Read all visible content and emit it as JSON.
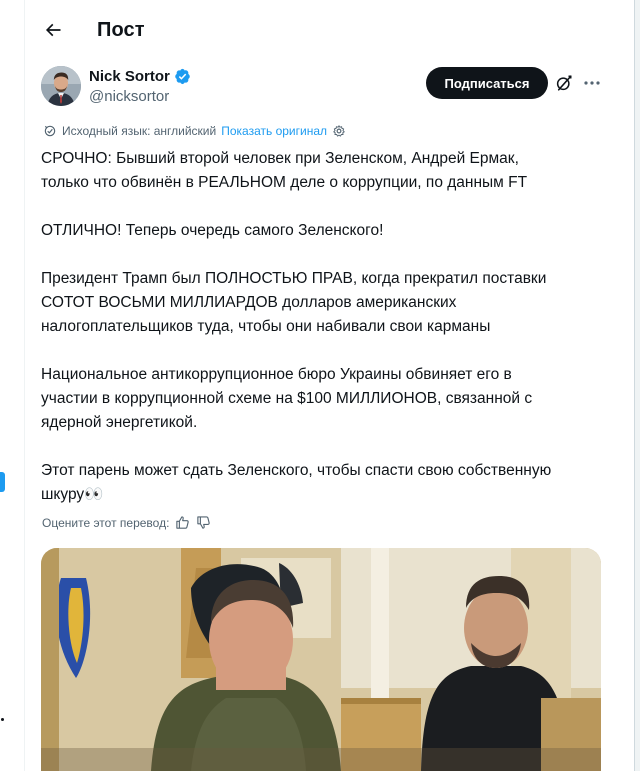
{
  "header": {
    "title": "Пост"
  },
  "author": {
    "name": "Nick Sortor",
    "handle": "@nicksortor",
    "follow_label": "Подписаться"
  },
  "translation": {
    "source_label": "Исходный язык: английский",
    "show_original": "Показать оригинал"
  },
  "tweet": {
    "paragraphs": [
      [
        "СРОЧНО: Бывший второй человек при Зеленском, Андрей Ермак,",
        "только что обвинён в РЕАЛЬНОМ деле о коррупции, по данным FT"
      ],
      [
        "ОТЛИЧНО! Теперь очередь самого Зеленского!"
      ],
      [
        "Президент Трамп был ПОЛНОСТЬЮ ПРАВ, когда прекратил поставки",
        "СОТОТ ВОСЬМИ МИЛЛИАРДОВ долларов американских",
        "налогоплательщиков туда, чтобы они набивали свои карманы"
      ],
      [
        "Национальное антикоррупционное бюро Украины обвиняет его в",
        "участии в коррупционной схеме на $100 МИЛЛИОНОВ, связанной с",
        "ядерной энергетикой."
      ],
      [
        "Этот парень может сдать Зеленского, чтобы спасти свою собственную",
        "шкуру👀"
      ]
    ]
  },
  "rating": {
    "label": "Оцените этот перевод:"
  },
  "icons": {
    "back": "arrow-left-icon",
    "verified": "verified-badge-icon",
    "grok": "grok-icon",
    "more": "more-dots-icon",
    "translate": "translate-icon",
    "settings": "gear-icon",
    "thumbs_up": "thumbs-up-icon",
    "thumbs_down": "thumbs-down-icon"
  },
  "colors": {
    "text": "#0f1419",
    "secondary": "#536471",
    "link": "#1d9bf0",
    "follow_bg": "#0f1419",
    "verified": "#1d9bf0"
  }
}
